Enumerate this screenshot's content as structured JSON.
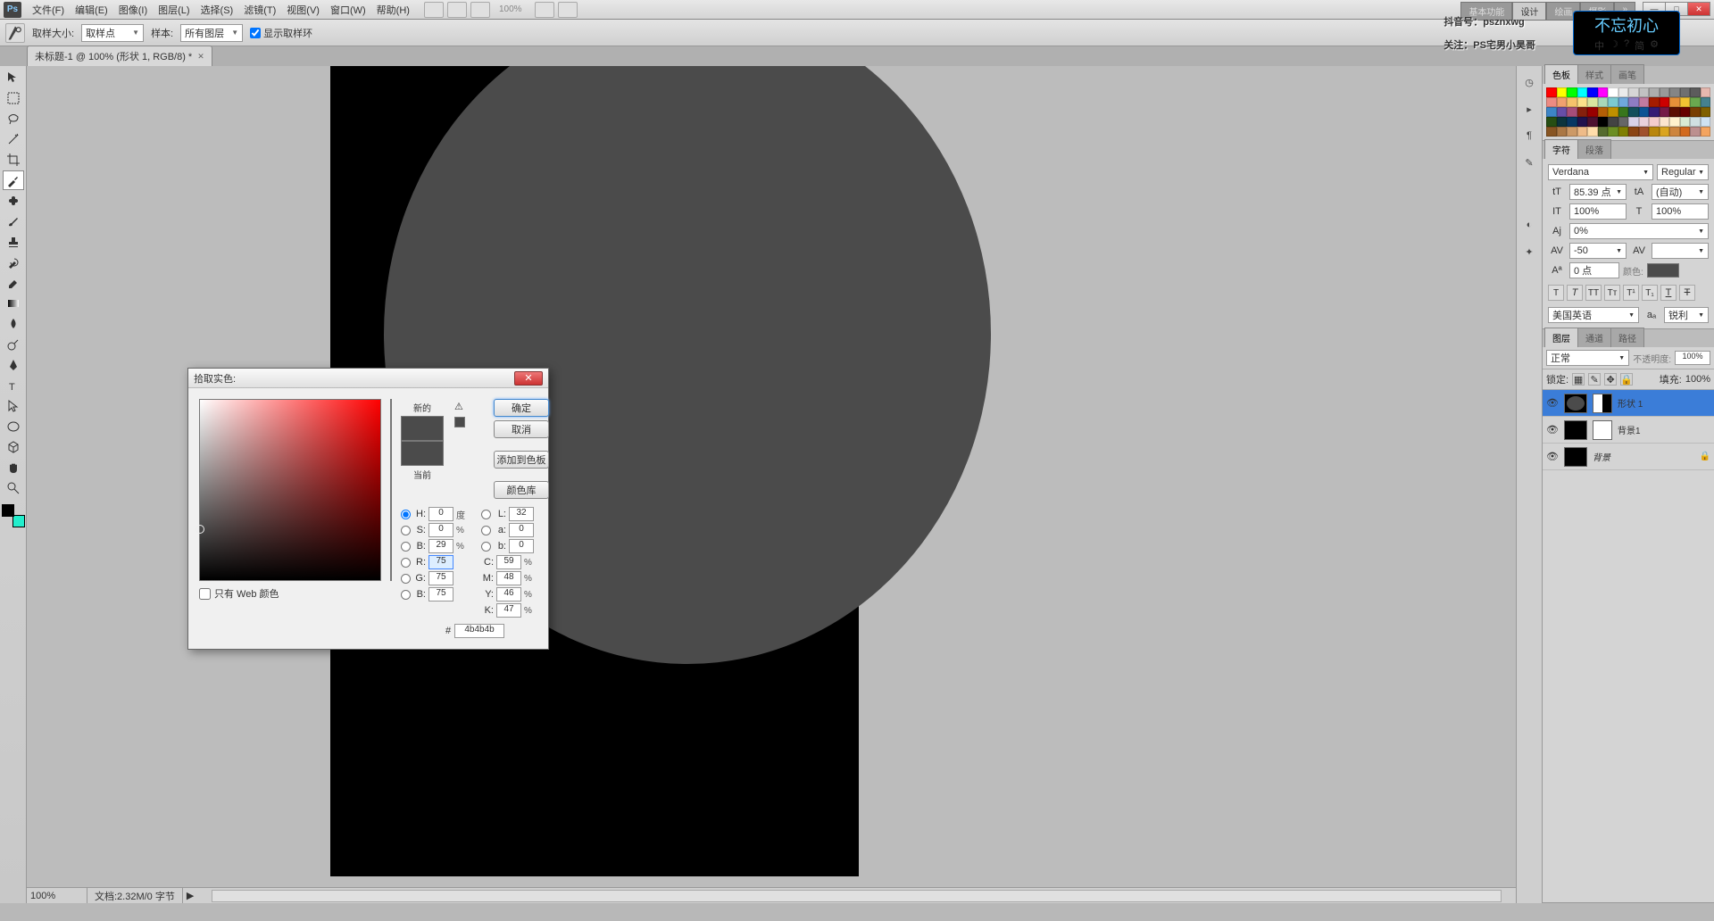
{
  "menu": {
    "items": [
      "文件(F)",
      "编辑(E)",
      "图像(I)",
      "图层(L)",
      "选择(S)",
      "滤镜(T)",
      "视图(V)",
      "窗口(W)",
      "帮助(H)"
    ]
  },
  "top": {
    "zoom": "100%",
    "workspaces": [
      "基本功能",
      "设计",
      "绘画",
      "摄影"
    ],
    "ws_more": "»"
  },
  "win": {
    "min": "—",
    "max": "□",
    "close": "✕"
  },
  "optbar": {
    "label_size": "取样大小:",
    "val_size": "取样点",
    "label_sample": "样本:",
    "val_sample": "所有图层",
    "chk": "显示取样环"
  },
  "doctab": {
    "title": "未标题-1 @ 100% (形状 1, RGB/8) *"
  },
  "status": {
    "zoom": "100%",
    "info": "文档:2.32M/0 字节"
  },
  "dialog": {
    "title": "拾取实色:",
    "new": "新的",
    "current": "当前",
    "btn_ok": "确定",
    "btn_cancel": "取消",
    "btn_add": "添加到色板",
    "btn_lib": "颜色库",
    "webonly": "只有 Web 颜色",
    "fields": {
      "H": {
        "v": "0",
        "u": "度"
      },
      "S": {
        "v": "0",
        "u": "%"
      },
      "Bv": {
        "v": "29",
        "u": "%"
      },
      "R": {
        "v": "75"
      },
      "G": {
        "v": "75"
      },
      "Bb": {
        "v": "75"
      },
      "L": {
        "v": "32"
      },
      "a": {
        "v": "0"
      },
      "b": {
        "v": "0"
      },
      "C": {
        "v": "59",
        "u": "%"
      },
      "M": {
        "v": "48",
        "u": "%"
      },
      "Y": {
        "v": "46",
        "u": "%"
      },
      "K": {
        "v": "47",
        "u": "%"
      }
    },
    "hex": "4b4b4b",
    "color_new": "#4b4b4b",
    "color_cur": "#4b4b4b"
  },
  "panels": {
    "color_tabs": [
      "色板",
      "样式",
      "画笔"
    ],
    "char_tabs": [
      "字符",
      "段落"
    ],
    "char": {
      "font": "Verdana",
      "style": "Regular",
      "size": "85.39 点",
      "leading": "(自动)",
      "tracking": "100%",
      "vscale": "100%",
      "kerning": "0%",
      "tr": "-50",
      "baseline": "0 点",
      "color": "#4b4b4b",
      "lang": "美国英语",
      "aa": "锐利",
      "colorlbl": "颜色:"
    },
    "layer_tabs": [
      "图层",
      "通道",
      "路径"
    ],
    "layers": {
      "blend": "正常",
      "opacity_lbl": "不透明度:",
      "opacity": "100%",
      "fill_lbl": "填充:",
      "fill": "100%",
      "lock_lbl": "锁定:",
      "items": [
        {
          "name": "形状 1",
          "sel": true,
          "mask": true
        },
        {
          "name": "背景1",
          "sel": false,
          "mask": true
        },
        {
          "name": "背景",
          "sel": false,
          "locked": true
        }
      ]
    }
  },
  "watermark": {
    "l1": "抖音号：psznxwg",
    "l2": "关注：PS宅男小昊哥"
  },
  "badge": {
    "title": "不忘初心",
    "items": [
      "中",
      "☽",
      "?",
      "简",
      "⚙"
    ]
  },
  "swatch_colors": [
    "#ff0000",
    "#ffff00",
    "#00ff00",
    "#00ffff",
    "#0000ff",
    "#ff00ff",
    "#ffffff",
    "#ebebeb",
    "#d6d6d6",
    "#c2c2c2",
    "#adadad",
    "#999999",
    "#858585",
    "#707070",
    "#5c5c5c",
    "#e6b8af",
    "#ec8b83",
    "#f0a06f",
    "#f5c26b",
    "#fce38a",
    "#d9e79f",
    "#a8d8b9",
    "#7ccad1",
    "#6fa8dc",
    "#8e7cc3",
    "#c27ba0",
    "#a61c00",
    "#cc0000",
    "#e69138",
    "#f1c232",
    "#6aa84f",
    "#45818e",
    "#3d85c6",
    "#674ea7",
    "#a64d79",
    "#85200c",
    "#990000",
    "#b45f06",
    "#bf9000",
    "#38761d",
    "#134f5c",
    "#0b5394",
    "#351c75",
    "#741b47",
    "#5b0f00",
    "#660000",
    "#783f04",
    "#7f6000",
    "#274e13",
    "#0c343d",
    "#073763",
    "#20124d",
    "#4c1130",
    "#000000",
    "#434343",
    "#666666",
    "#d9d2e9",
    "#ead1dc",
    "#f4cccc",
    "#fce5cd",
    "#fff2cc",
    "#d9ead3",
    "#d0e0e3",
    "#cfe2f3",
    "#885522",
    "#aa7744",
    "#cc9966",
    "#eebb88",
    "#ffddaa",
    "#556b2f",
    "#6b8e23",
    "#808000",
    "#8b4513",
    "#a0522d",
    "#b8860b",
    "#daa520",
    "#cd853f",
    "#d2691e",
    "#bc8f8f",
    "#f4a460"
  ]
}
